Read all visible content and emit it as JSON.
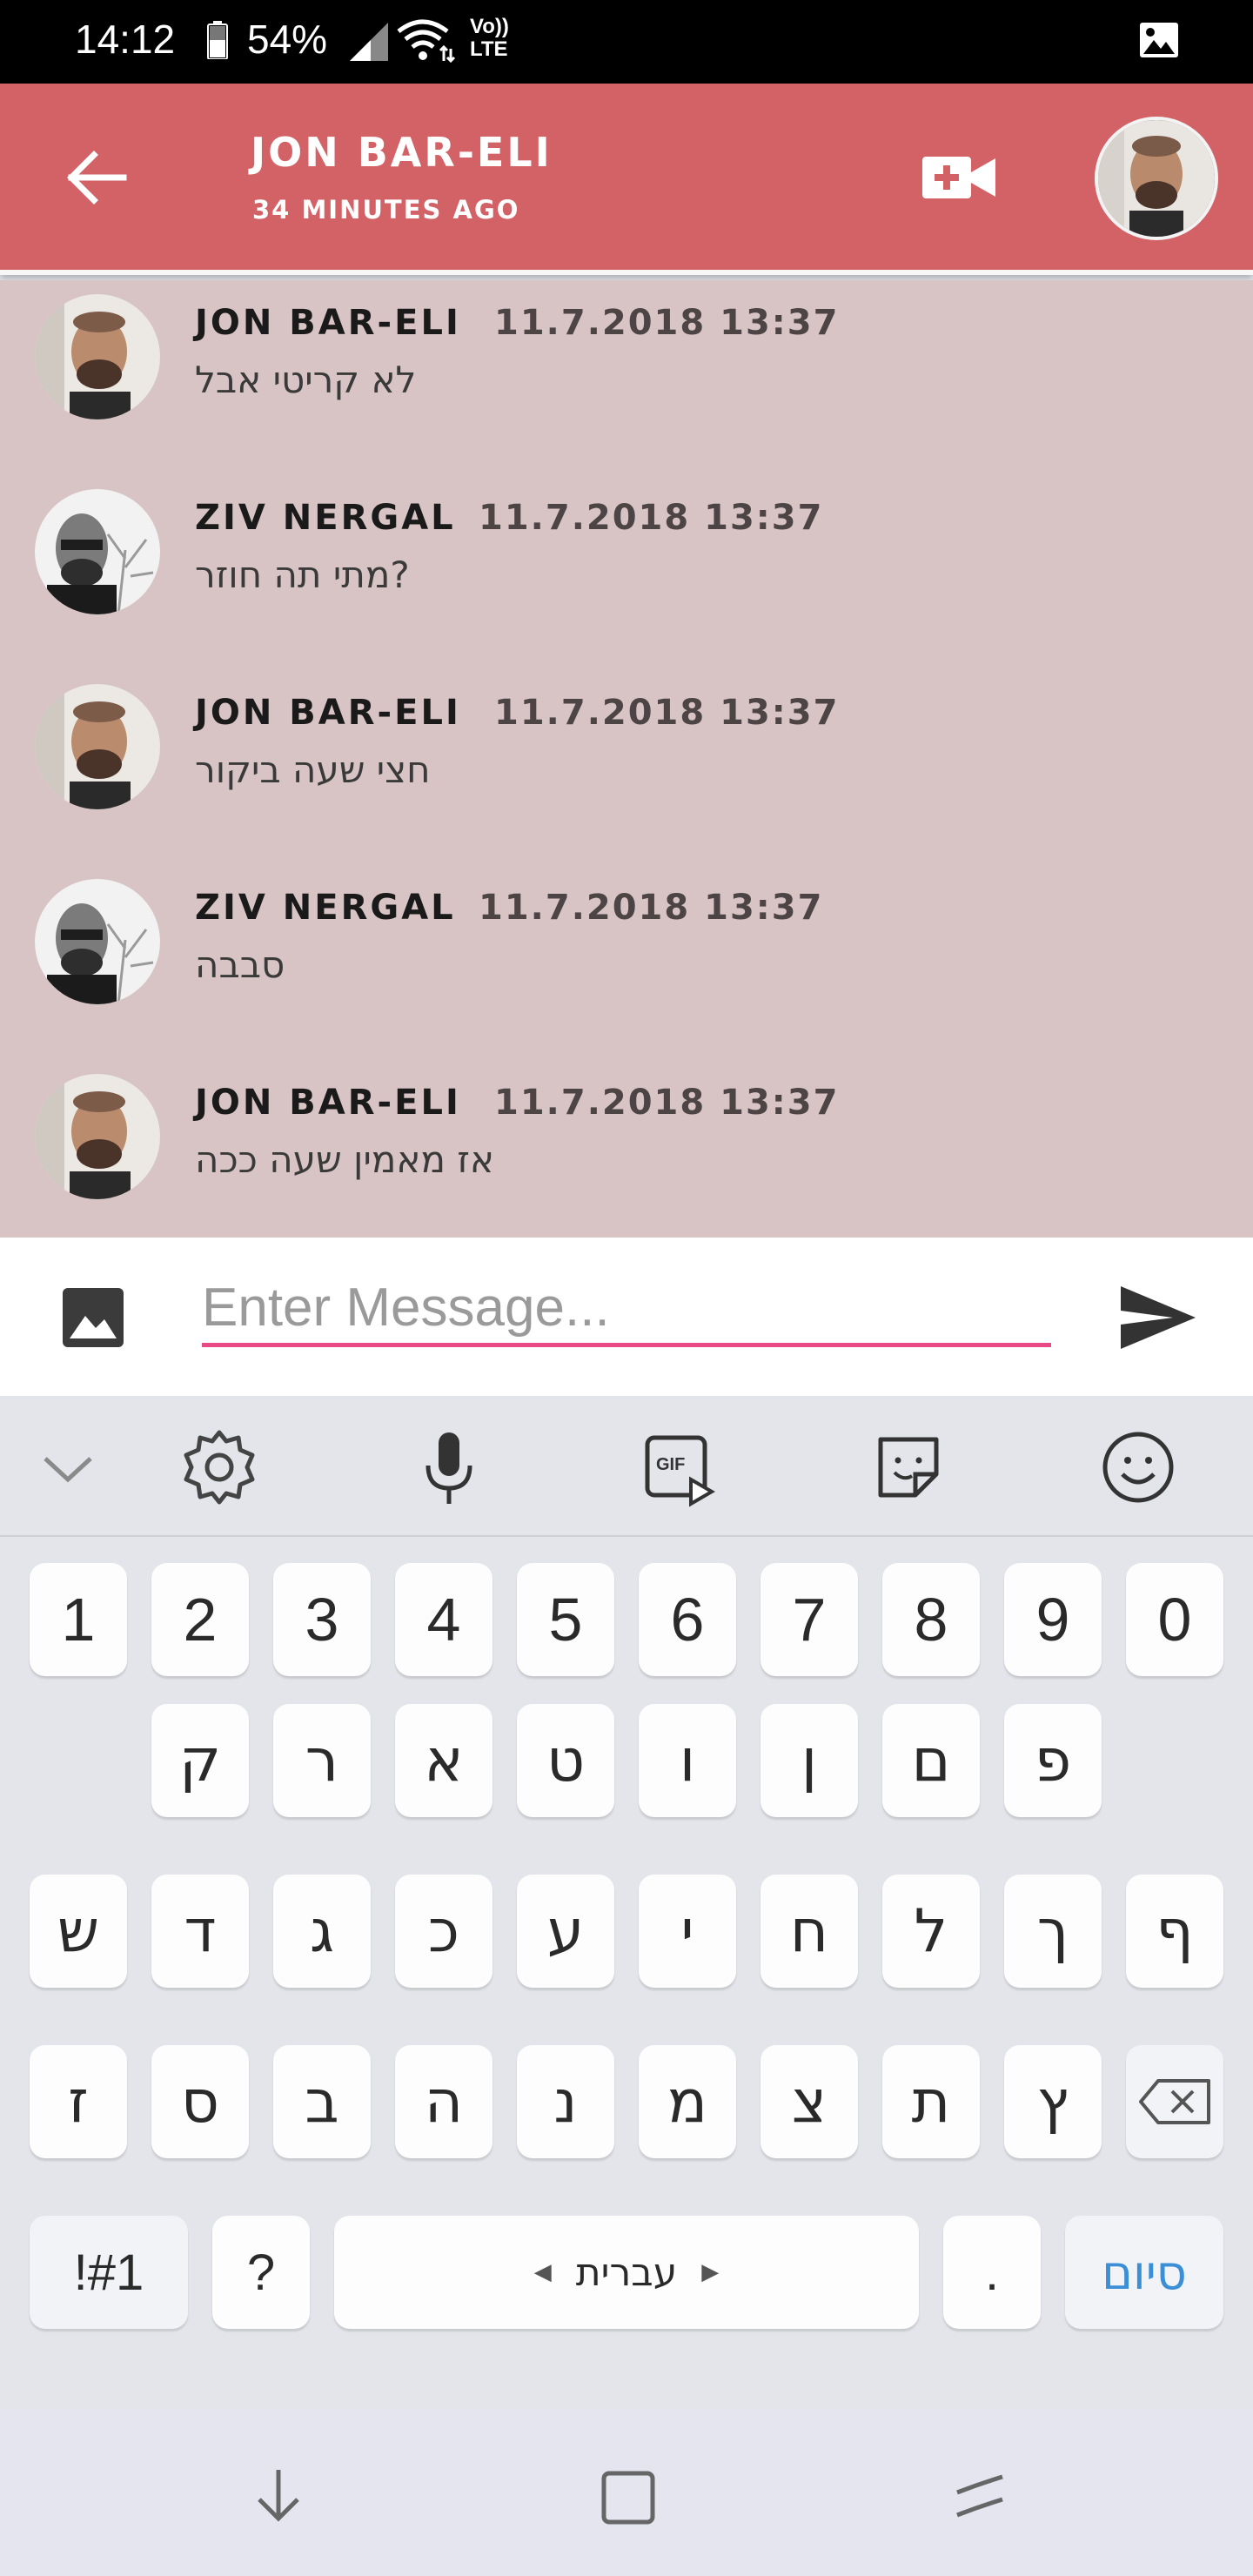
{
  "status_bar": {
    "time": "14:12",
    "battery": "54%",
    "network_line1": "Vo))",
    "network_line2": "LTE",
    "icons": [
      "battery-icon",
      "signal-icon",
      "wifi-icon",
      "image-icon"
    ]
  },
  "header": {
    "contact_name": "JON BAR-ELI",
    "last_seen": "34 MINUTES AGO",
    "icons": [
      "back-arrow-icon",
      "video-call-icon",
      "avatar"
    ]
  },
  "messages": [
    {
      "sender": "JON BAR-ELI",
      "time": "11.7.2018 13:37",
      "text": "לא קריטי אבל"
    },
    {
      "sender": "ZIV NERGAL",
      "time": "11.7.2018 13:37",
      "text": "מתי תה חוזר?"
    },
    {
      "sender": "JON BAR-ELI",
      "time": "11.7.2018 13:37",
      "text": "חצי שעה ביקור"
    },
    {
      "sender": "ZIV NERGAL",
      "time": "11.7.2018 13:37",
      "text": "סבבה"
    },
    {
      "sender": "JON BAR-ELI",
      "time": "11.7.2018 13:37",
      "text": "אז מאמין שעה ככה"
    }
  ],
  "composer": {
    "placeholder": "Enter Message...",
    "value": "",
    "accent_color": "#e94a85"
  },
  "keyboard": {
    "toolbar_icons": [
      "chevron-down-icon",
      "settings-icon",
      "microphone-icon",
      "gif-icon",
      "sticker-icon",
      "emoji-icon"
    ],
    "gif_label": "GIF",
    "number_row": [
      "1",
      "2",
      "3",
      "4",
      "5",
      "6",
      "7",
      "8",
      "9",
      "0"
    ],
    "row1": [
      "ק",
      "ר",
      "א",
      "ט",
      "ו",
      "ן",
      "ם",
      "פ"
    ],
    "row2": [
      "ש",
      "ד",
      "ג",
      "כ",
      "ע",
      "י",
      "ח",
      "ל",
      "ך",
      "ף"
    ],
    "row3": [
      "ז",
      "ס",
      "ב",
      "ה",
      "נ",
      "מ",
      "צ",
      "ת",
      "ץ"
    ],
    "symbols_key": "!#1",
    "question_key": "?",
    "space_label": "עברית",
    "period_key": ".",
    "done_key": "סיום"
  },
  "nav_bar": {
    "icons": [
      "back-down-icon",
      "home-square-icon",
      "recents-icon"
    ]
  },
  "colors": {
    "header": "#d36267",
    "chat_background": "#d8c4c5",
    "done_key": "#3a8fd6"
  }
}
